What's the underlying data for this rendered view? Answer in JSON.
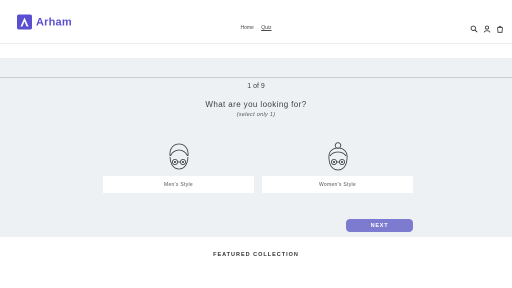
{
  "header": {
    "brand": "Arham",
    "logo_color": "#5b4fd1",
    "nav": [
      {
        "label": "Home",
        "active": false
      },
      {
        "label": "Quiz",
        "active": true
      }
    ],
    "icons": [
      "search-icon",
      "account-icon",
      "cart-icon"
    ]
  },
  "quiz": {
    "progress": "1 of 9",
    "question": "What are you looking for?",
    "hint": "(select only 1)",
    "options": [
      {
        "label": "Men's Style",
        "icon": "man-avatar-icon"
      },
      {
        "label": "Women's Style",
        "icon": "woman-avatar-icon"
      }
    ],
    "next_label": "NEXT",
    "accent": "#7c7bd0"
  },
  "featured": {
    "title": "FEATURED COLLECTION"
  }
}
